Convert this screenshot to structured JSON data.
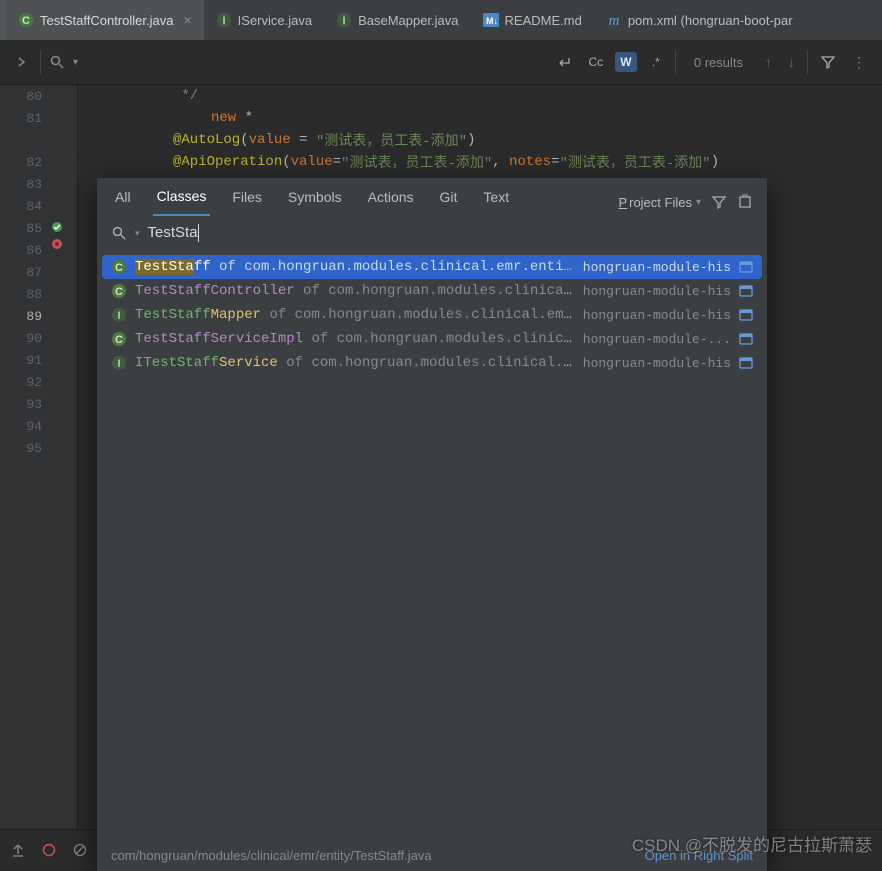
{
  "tabs": [
    {
      "icon": "class",
      "label": "TestStaffController.java",
      "active": true,
      "closable": true
    },
    {
      "icon": "interface",
      "label": "IService.java"
    },
    {
      "icon": "interface",
      "label": "BaseMapper.java"
    },
    {
      "icon": "md",
      "label": "README.md"
    },
    {
      "icon": "maven",
      "label": "pom.xml (hongruan-boot-par"
    }
  ],
  "searchBar": {
    "matchCase": "Cc",
    "word": "W",
    "regex": ".*",
    "results": "0 results"
  },
  "lines": [
    {
      "n": "80",
      "frag": [
        {
          "c": "t-grey",
          "t": " */"
        }
      ]
    },
    {
      "n": "81",
      "frag": [
        {
          "c": "t-key",
          "t": "new "
        },
        {
          "c": "t-white",
          "t": "*"
        }
      ],
      "indent": 38
    },
    {
      "n": "81",
      "frag": [
        {
          "c": "t-ann",
          "t": "@AutoLog"
        },
        {
          "c": "t-eq",
          "t": "("
        },
        {
          "c": "t-par",
          "t": "value"
        },
        {
          "c": "t-eq",
          "t": " = "
        },
        {
          "c": "t-str",
          "t": "\"测试表，员工表-添加\""
        },
        {
          "c": "t-eq",
          "t": ")"
        }
      ]
    },
    {
      "n": "82",
      "frag": [
        {
          "c": "t-ann",
          "t": "@ApiOperation"
        },
        {
          "c": "t-eq",
          "t": "("
        },
        {
          "c": "t-par",
          "t": "value"
        },
        {
          "c": "t-eq",
          "t": "="
        },
        {
          "c": "t-str",
          "t": "\"测试表，员工表-添加\""
        },
        {
          "c": "t-eq",
          "t": ", "
        },
        {
          "c": "t-par",
          "t": "notes"
        },
        {
          "c": "t-eq",
          "t": "="
        },
        {
          "c": "t-str",
          "t": "\"测试表，员工表-添加\""
        },
        {
          "c": "t-eq",
          "t": ")"
        }
      ]
    },
    {
      "n": "83"
    },
    {
      "n": "84"
    },
    {
      "n": "85",
      "mark": true
    },
    {
      "n": "86"
    },
    {
      "n": "87"
    },
    {
      "n": "88"
    },
    {
      "n": "89",
      "current": true
    },
    {
      "n": "90"
    },
    {
      "n": "91"
    },
    {
      "n": "92"
    },
    {
      "n": "93"
    },
    {
      "n": "94"
    },
    {
      "n": "95"
    }
  ],
  "dialog": {
    "tabs": [
      "All",
      "Classes",
      "Files",
      "Symbols",
      "Actions",
      "Git",
      "Text"
    ],
    "activeTab": 1,
    "scope": {
      "prefix": "P",
      "label": "roject Files"
    },
    "searchValue": "TestSta",
    "rows": [
      {
        "icon": "class",
        "sel": true,
        "hl": "TestSta",
        "rest": "ff",
        "pkg": "of com.hongruan.modules.clinical.emr.entity",
        "mod": "hongruan-module-his"
      },
      {
        "icon": "class",
        "hl": "TestStaff",
        "rest": "Controller",
        "pkg": "of com.hongruan.modules.clinical.emr.controller",
        "mod": "hongruan-module-his",
        "restColor": "#b389c5"
      },
      {
        "icon": "interface",
        "hl": "TestStaff",
        "rest": "Mapper",
        "pkg": "of com.hongruan.modules.clinical.emr.mapper",
        "mod": "hongruan-module-his",
        "restColor": "#e8bf6a"
      },
      {
        "icon": "class",
        "hl": "TestStaff",
        "rest": "ServiceImpl",
        "pkg": "of com.hongruan.modules.clinical.emr.service.impl",
        "mod": "hongruan-module-...",
        "restColor": "#b389c5"
      },
      {
        "icon": "interface",
        "hl": "ITestStaff",
        "rest": "Service",
        "pkg": "of com.hongruan.modules.clinical.emr.service",
        "mod": "hongruan-module-his",
        "restColor": "#e8bf6a",
        "hlColor": "#6fb36f"
      }
    ],
    "open": "Open in Right Split",
    "path": "com/hongruan/modules/clinical/emr/entity/TestStaff.java"
  },
  "watermark": "CSDN @不脱发的尼古拉斯萧瑟"
}
